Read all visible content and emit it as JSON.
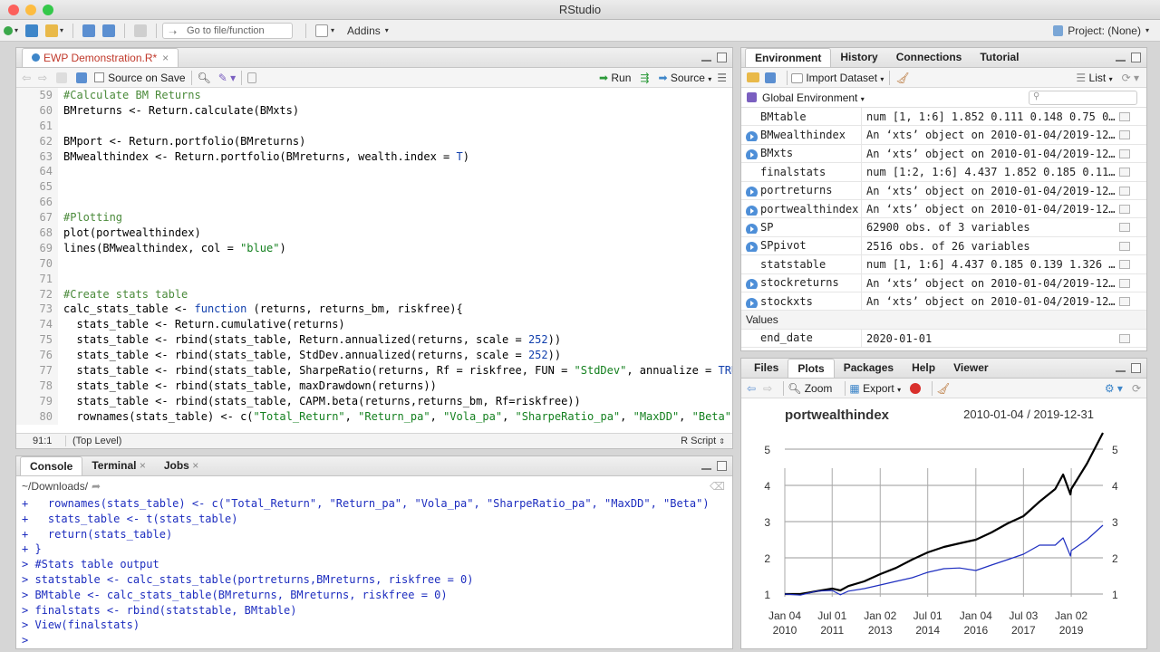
{
  "window": {
    "title": "RStudio"
  },
  "toolbar": {
    "goto_placeholder": "Go to file/function",
    "addins_label": "Addins",
    "project_label": "Project: (None)"
  },
  "editor": {
    "tab_label": "EWP Demonstration.R*",
    "source_on_save": "Source on Save",
    "run_label": "Run",
    "source_label": "Source",
    "lines": [
      {
        "n": "59",
        "html": "<span class=\"cm\">#Calculate BM Returns</span>"
      },
      {
        "n": "60",
        "html": "BMreturns &lt;- Return.calculate(BMxts)"
      },
      {
        "n": "61",
        "html": ""
      },
      {
        "n": "62",
        "html": "BMport &lt;- Return.portfolio(BMreturns)"
      },
      {
        "n": "63",
        "html": "BMwealthindex &lt;- Return.portfolio(BMreturns, wealth.index = <span class=\"kw\">T</span>)"
      },
      {
        "n": "64",
        "html": ""
      },
      {
        "n": "65",
        "html": ""
      },
      {
        "n": "66",
        "html": ""
      },
      {
        "n": "67",
        "html": "<span class=\"cm\">#Plotting</span>"
      },
      {
        "n": "68",
        "html": "plot(portwealthindex)"
      },
      {
        "n": "69",
        "html": "lines(BMwealthindex, col = <span class=\"st\">\"blue\"</span>)"
      },
      {
        "n": "70",
        "html": ""
      },
      {
        "n": "71",
        "html": ""
      },
      {
        "n": "72",
        "html": "<span class=\"cm\">#Create stats table</span>"
      },
      {
        "n": "73",
        "html": "calc_stats_table &lt;- <span class=\"kw\">function</span> (returns, returns_bm, riskfree){"
      },
      {
        "n": "74",
        "html": "  stats_table &lt;- Return.cumulative(returns)"
      },
      {
        "n": "75",
        "html": "  stats_table &lt;- rbind(stats_table, Return.annualized(returns, scale = <span class=\"nm\">252</span>))"
      },
      {
        "n": "76",
        "html": "  stats_table &lt;- rbind(stats_table, StdDev.annualized(returns, scale = <span class=\"nm\">252</span>))"
      },
      {
        "n": "77",
        "html": "  stats_table &lt;- rbind(stats_table, SharpeRatio(returns, Rf = riskfree, FUN = <span class=\"st\">\"StdDev\"</span>, annualize = <span class=\"kw\">TRUE</span>"
      },
      {
        "n": "78",
        "html": "  stats_table &lt;- rbind(stats_table, maxDrawdown(returns))"
      },
      {
        "n": "79",
        "html": "  stats_table &lt;- rbind(stats_table, CAPM.beta(returns,returns_bm, Rf=riskfree))"
      },
      {
        "n": "80",
        "html": "  rownames(stats_table) &lt;- c(<span class=\"st\">\"Total_Return\"</span>, <span class=\"st\">\"Return_pa\"</span>, <span class=\"st\">\"Vola_pa\"</span>, <span class=\"st\">\"SharpeRatio_pa\"</span>, <span class=\"st\">\"MaxDD\"</span>, <span class=\"st\">\"Beta\"</span>)"
      }
    ],
    "status_pos": "91:1",
    "status_level": "(Top Level)",
    "status_type": "R Script"
  },
  "console": {
    "tabs": [
      "Console",
      "Terminal",
      "Jobs"
    ],
    "path": "~/Downloads/",
    "lines": [
      "+   rownames(stats_table) <- c(\"Total_Return\", \"Return_pa\", \"Vola_pa\", \"SharpeRatio_pa\", \"MaxDD\", \"Beta\")",
      "+   stats_table <- t(stats_table)",
      "+   return(stats_table)",
      "+ }",
      "> #Stats table output",
      "> statstable <- calc_stats_table(portreturns,BMreturns, riskfree = 0)",
      "> BMtable <- calc_stats_table(BMreturns, BMreturns, riskfree = 0)",
      "> finalstats <- rbind(statstable, BMtable)",
      "> View(finalstats)",
      ">"
    ]
  },
  "environment": {
    "tabs": [
      "Environment",
      "History",
      "Connections",
      "Tutorial"
    ],
    "import_label": "Import Dataset",
    "list_label": "List",
    "scope_label": "Global Environment",
    "rows": [
      {
        "name": "BMtable",
        "value": "num [1, 1:6] 1.852 0.111 0.148 0.75 0…",
        "arrow": false
      },
      {
        "name": "BMwealthindex",
        "value": "An ‘xts’ object on 2010-01-04/2019-12…",
        "arrow": true
      },
      {
        "name": "BMxts",
        "value": "An ‘xts’ object on 2010-01-04/2019-12…",
        "arrow": true
      },
      {
        "name": "finalstats",
        "value": "num [1:2, 1:6] 4.437 1.852 0.185 0.11…",
        "arrow": false
      },
      {
        "name": "portreturns",
        "value": "An ‘xts’ object on 2010-01-04/2019-12…",
        "arrow": true
      },
      {
        "name": "portwealthindex",
        "value": "An ‘xts’ object on 2010-01-04/2019-12…",
        "arrow": true
      },
      {
        "name": "SP",
        "value": "62900 obs. of 3 variables",
        "arrow": true
      },
      {
        "name": "SPpivot",
        "value": "2516 obs. of 26 variables",
        "arrow": true
      },
      {
        "name": "statstable",
        "value": "num [1, 1:6] 4.437 0.185 0.139 1.326 …",
        "arrow": false
      },
      {
        "name": "stockreturns",
        "value": "An ‘xts’ object on 2010-01-04/2019-12…",
        "arrow": true
      },
      {
        "name": "stockxts",
        "value": "An ‘xts’ object on 2010-01-04/2019-12…",
        "arrow": true
      }
    ],
    "values_header": "Values",
    "value_rows": [
      {
        "name": "end_date",
        "value": "2020-01-01"
      }
    ]
  },
  "files": {
    "tabs": [
      "Files",
      "Plots",
      "Packages",
      "Help",
      "Viewer"
    ],
    "zoom_label": "Zoom",
    "export_label": "Export"
  },
  "colors": {
    "port_line": "#000000",
    "bm_line": "#1f2fc0",
    "accent": "#4e8fd8"
  },
  "chart_data": {
    "type": "line",
    "title": "portwealthindex",
    "date_range": "2010-01-04 / 2019-12-31",
    "ylim": [
      0.8,
      5.6
    ],
    "yticks": [
      1,
      2,
      3,
      4,
      5
    ],
    "xticks": [
      {
        "label": [
          "Jan 04",
          "2010"
        ],
        "date": "2010-01-04"
      },
      {
        "label": [
          "Jul 01",
          "2011"
        ],
        "date": "2011-07-01"
      },
      {
        "label": [
          "Jan 02",
          "2013"
        ],
        "date": "2013-01-02"
      },
      {
        "label": [
          "Jul 01",
          "2014"
        ],
        "date": "2014-07-01"
      },
      {
        "label": [
          "Jan 04",
          "2016"
        ],
        "date": "2016-01-04"
      },
      {
        "label": [
          "Jul 03",
          "2017"
        ],
        "date": "2017-07-03"
      },
      {
        "label": [
          "Jan 02",
          "2019"
        ],
        "date": "2019-01-02"
      }
    ],
    "series": [
      {
        "name": "portwealthindex",
        "dates": [
          "2010-01-04",
          "2010-07-01",
          "2011-01-03",
          "2011-07-01",
          "2011-10-03",
          "2012-01-03",
          "2012-07-02",
          "2013-01-02",
          "2013-07-01",
          "2014-01-02",
          "2014-07-01",
          "2015-01-02",
          "2015-07-01",
          "2016-01-04",
          "2016-07-01",
          "2017-01-03",
          "2017-07-03",
          "2018-01-02",
          "2018-07-02",
          "2018-10-01",
          "2018-12-24",
          "2019-01-02",
          "2019-07-01",
          "2019-12-31"
        ],
        "values": [
          1.0,
          1.0,
          1.08,
          1.15,
          1.1,
          1.22,
          1.35,
          1.55,
          1.72,
          1.95,
          2.15,
          2.3,
          2.4,
          2.5,
          2.7,
          2.95,
          3.15,
          3.55,
          3.9,
          4.3,
          3.75,
          3.9,
          4.6,
          5.45
        ]
      },
      {
        "name": "BMwealthindex",
        "dates": [
          "2010-01-04",
          "2010-07-01",
          "2011-01-03",
          "2011-07-01",
          "2011-10-03",
          "2012-01-03",
          "2012-07-02",
          "2013-01-02",
          "2013-07-01",
          "2014-01-02",
          "2014-07-01",
          "2015-01-02",
          "2015-07-01",
          "2016-01-04",
          "2016-07-01",
          "2017-01-03",
          "2017-07-03",
          "2018-01-02",
          "2018-07-02",
          "2018-10-01",
          "2018-12-24",
          "2019-01-02",
          "2019-07-01",
          "2019-12-31"
        ],
        "values": [
          1.0,
          0.97,
          1.08,
          1.1,
          0.98,
          1.08,
          1.15,
          1.25,
          1.35,
          1.45,
          1.6,
          1.7,
          1.72,
          1.65,
          1.8,
          1.95,
          2.1,
          2.35,
          2.35,
          2.55,
          2.05,
          2.2,
          2.5,
          2.9
        ]
      }
    ]
  }
}
